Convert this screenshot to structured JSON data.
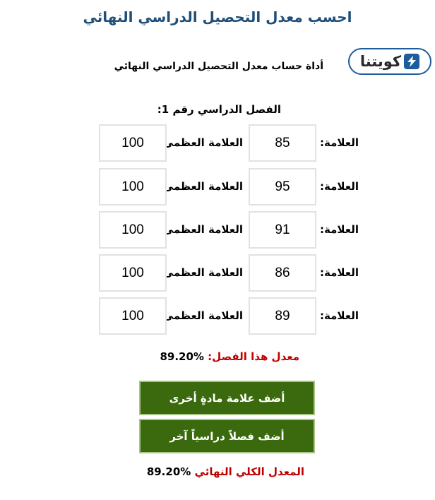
{
  "page": {
    "title": "احسب معدل التحصيل الدراسي النهائي",
    "tool_title": "أداة حساب معدل التحصيل الدراسي النهائي"
  },
  "logo": {
    "text": "كويتنا",
    "icon": "lightning-bolt-icon",
    "color": "#1f5c9e"
  },
  "term": {
    "heading": "الفصل الدراسي رقم 1:",
    "grade_label": "العلامة:",
    "max_label": "العلامة العظمى:",
    "rows": [
      {
        "grade": "85",
        "max": "100"
      },
      {
        "grade": "95",
        "max": "100"
      },
      {
        "grade": "91",
        "max": "100"
      },
      {
        "grade": "86",
        "max": "100"
      },
      {
        "grade": "89",
        "max": "100"
      }
    ],
    "average_label": "معدل هذا الفصل:",
    "average_value": "%89.20"
  },
  "buttons": {
    "add_subject": "أضف علامة مادةٍ أخرى",
    "add_term": "أضف فصلاً دراسياً آخر"
  },
  "final": {
    "label": "المعدل الكلي النهائي",
    "value": "%89.20"
  },
  "colors": {
    "title": "#1f4e79",
    "accent_red": "#c00000",
    "button_bg": "#3a6a0d",
    "button_border": "#a9c58a",
    "box_border": "#e2e2e2"
  }
}
